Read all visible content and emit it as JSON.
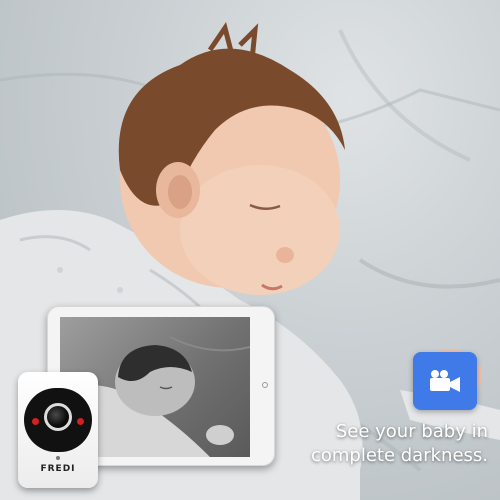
{
  "camera": {
    "brand": "FREDI"
  },
  "badge": {
    "icon": "video-camera-icon",
    "color": "#3f7ae8"
  },
  "caption": {
    "line1": "See your baby in",
    "line2": "complete darkness."
  }
}
